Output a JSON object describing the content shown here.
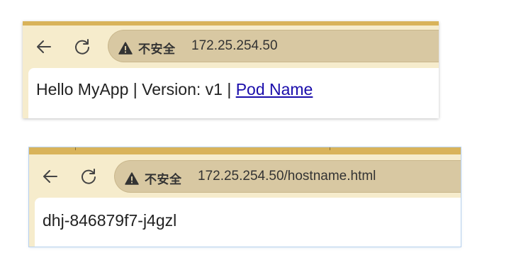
{
  "windows": [
    {
      "security_label": "不安全",
      "url": "172.25.254.50",
      "content": {
        "greeting": "Hello MyApp | Version: v1 | ",
        "link": "Pod Name"
      }
    },
    {
      "security_label": "不安全",
      "url": "172.25.254.50/hostname.html",
      "content": {
        "hostname": "dhj-846879f7-j4gzl"
      }
    }
  ],
  "colors": {
    "frame": "#f6eccc",
    "accent_bar": "#d9b35a",
    "omnibox": "#d8c8a2",
    "link": "#1a0dab"
  },
  "icons": [
    "back-arrow-icon",
    "reload-icon",
    "warning-triangle-icon"
  ]
}
